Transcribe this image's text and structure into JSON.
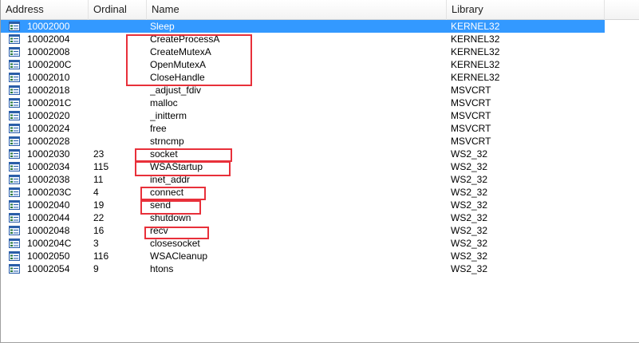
{
  "columns": [
    "Address",
    "Ordinal",
    "Name",
    "Library"
  ],
  "rows": [
    {
      "address": "10002000",
      "ordinal": "",
      "name": "Sleep",
      "library": "KERNEL32",
      "selected": true
    },
    {
      "address": "10002004",
      "ordinal": "",
      "name": "CreateProcessA",
      "library": "KERNEL32"
    },
    {
      "address": "10002008",
      "ordinal": "",
      "name": "CreateMutexA",
      "library": "KERNEL32"
    },
    {
      "address": "1000200C",
      "ordinal": "",
      "name": "OpenMutexA",
      "library": "KERNEL32"
    },
    {
      "address": "10002010",
      "ordinal": "",
      "name": "CloseHandle",
      "library": "KERNEL32"
    },
    {
      "address": "10002018",
      "ordinal": "",
      "name": "_adjust_fdiv",
      "library": "MSVCRT"
    },
    {
      "address": "1000201C",
      "ordinal": "",
      "name": "malloc",
      "library": "MSVCRT"
    },
    {
      "address": "10002020",
      "ordinal": "",
      "name": "_initterm",
      "library": "MSVCRT"
    },
    {
      "address": "10002024",
      "ordinal": "",
      "name": "free",
      "library": "MSVCRT"
    },
    {
      "address": "10002028",
      "ordinal": "",
      "name": "strncmp",
      "library": "MSVCRT"
    },
    {
      "address": "10002030",
      "ordinal": "23",
      "name": "socket",
      "library": "WS2_32"
    },
    {
      "address": "10002034",
      "ordinal": "115",
      "name": "WSAStartup",
      "library": "WS2_32"
    },
    {
      "address": "10002038",
      "ordinal": "11",
      "name": "inet_addr",
      "library": "WS2_32"
    },
    {
      "address": "1000203C",
      "ordinal": "4",
      "name": "connect",
      "library": "WS2_32"
    },
    {
      "address": "10002040",
      "ordinal": "19",
      "name": "send",
      "library": "WS2_32"
    },
    {
      "address": "10002044",
      "ordinal": "22",
      "name": "shutdown",
      "library": "WS2_32"
    },
    {
      "address": "10002048",
      "ordinal": "16",
      "name": "recv",
      "library": "WS2_32"
    },
    {
      "address": "1000204C",
      "ordinal": "3",
      "name": "closesocket",
      "library": "WS2_32"
    },
    {
      "address": "10002050",
      "ordinal": "116",
      "name": "WSACleanup",
      "library": "WS2_32"
    },
    {
      "address": "10002054",
      "ordinal": "9",
      "name": "htons",
      "library": "WS2_32"
    }
  ],
  "colors": {
    "selection": "#3399ff",
    "highlight_box": "#e8303a"
  },
  "row_icon": "import-function-icon"
}
